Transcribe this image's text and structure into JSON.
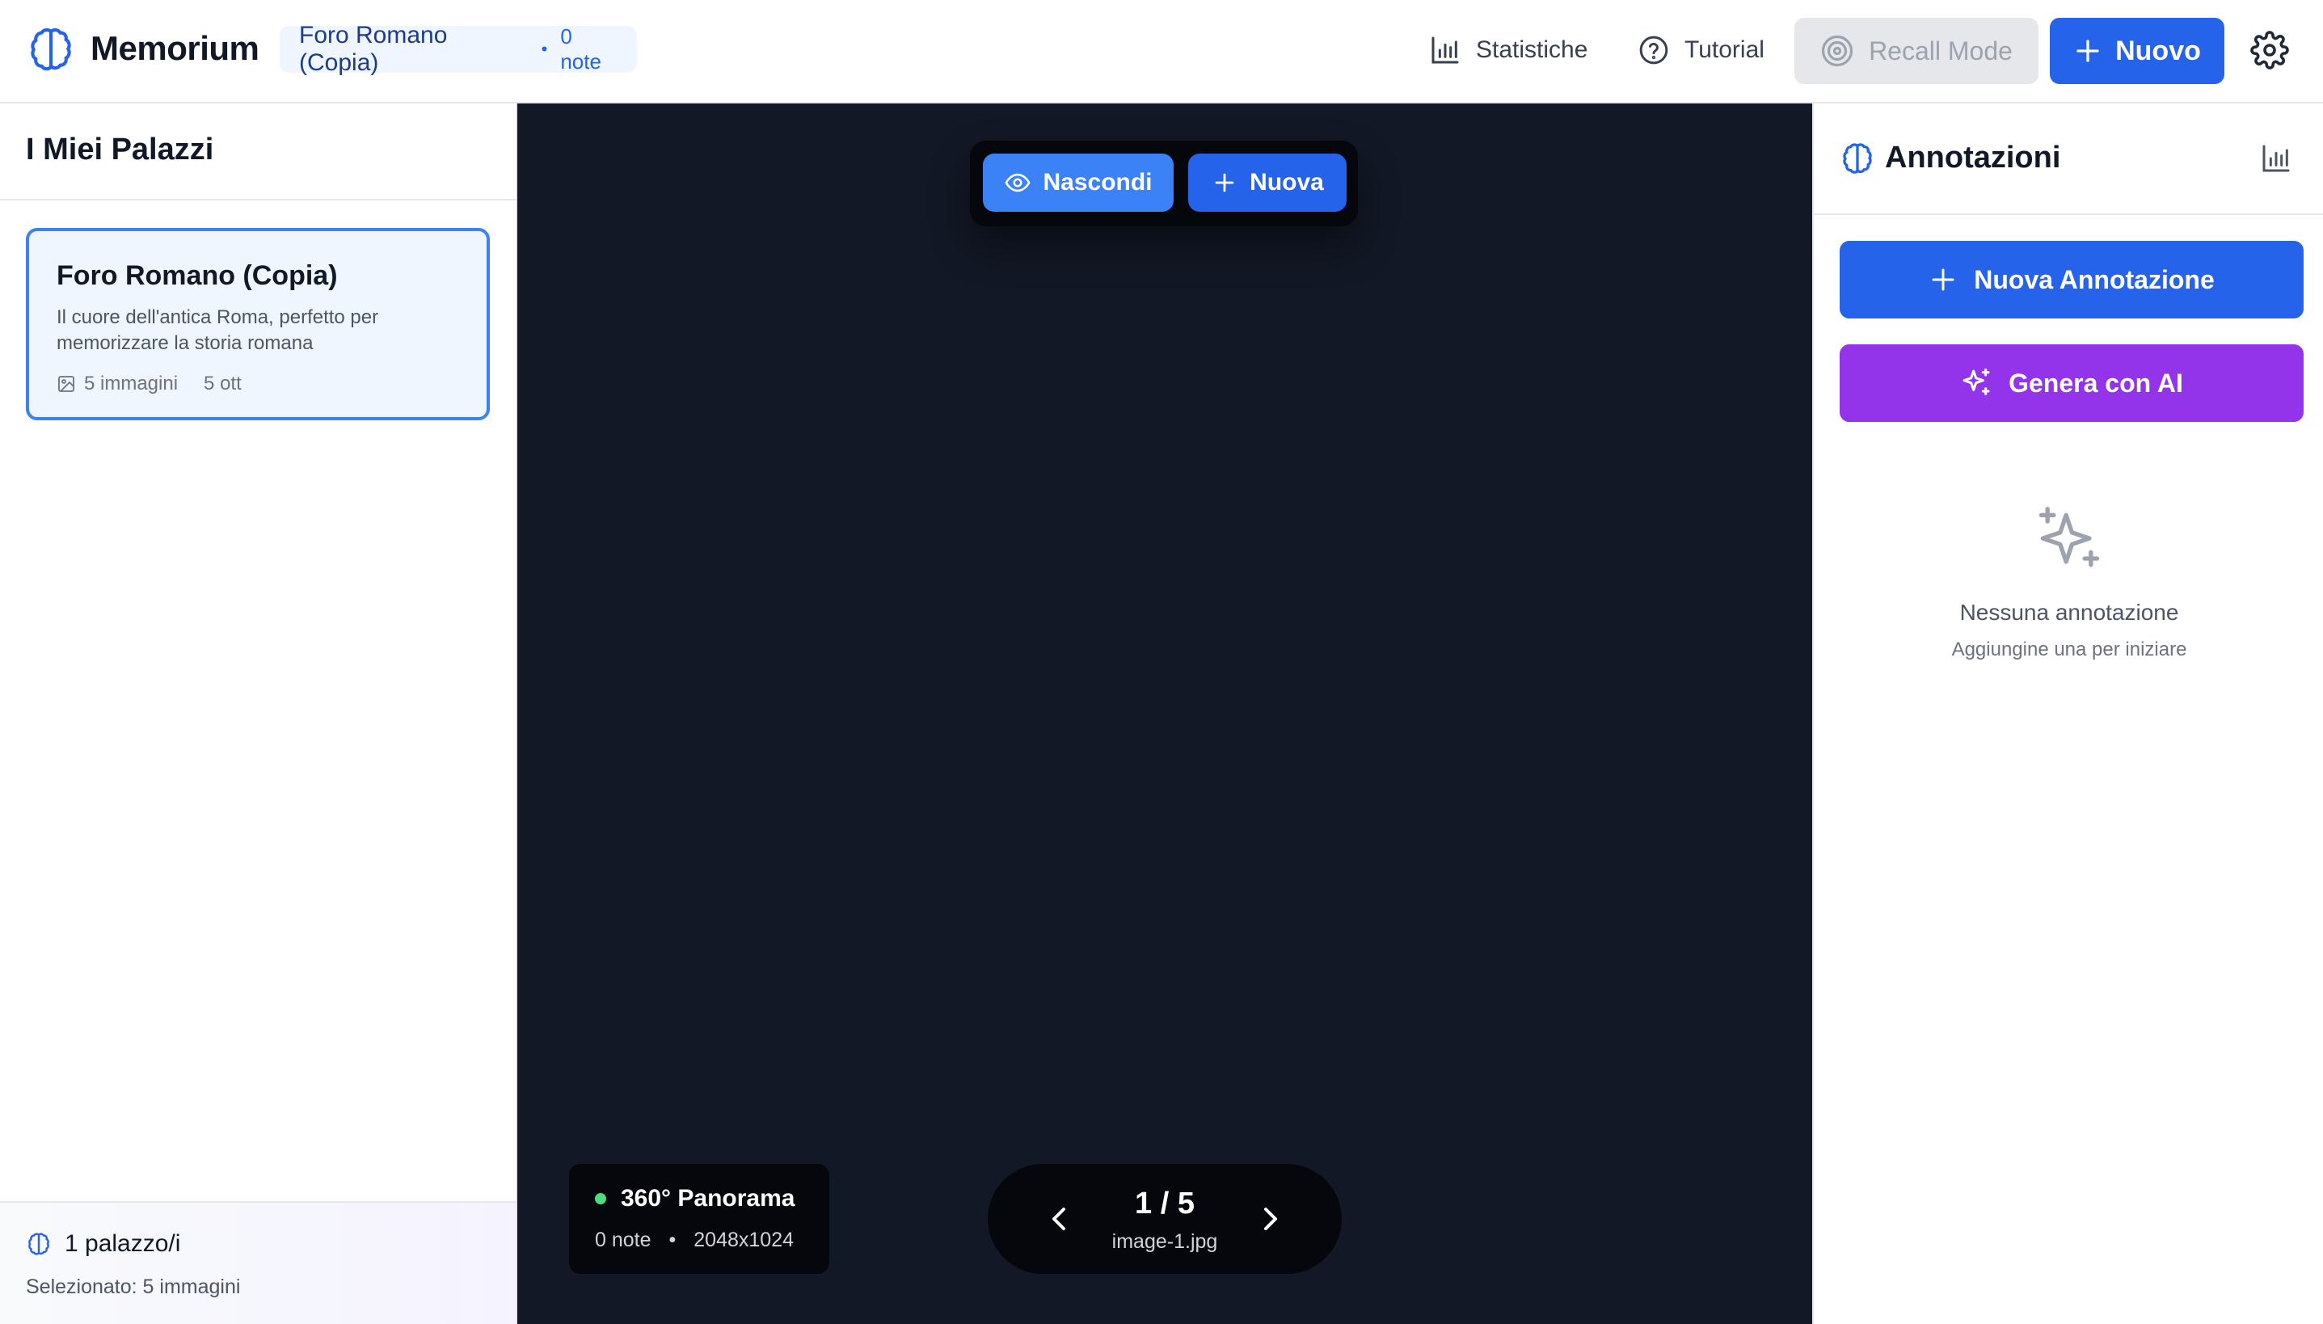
{
  "app": {
    "title": "Memorium",
    "current_palace": "Foro Romano (Copia)",
    "current_notes": "0 note"
  },
  "header": {
    "stats_label": "Statistiche",
    "tutorial_label": "Tutorial",
    "recall_label": "Recall Mode",
    "new_label": "Nuovo"
  },
  "sidebar": {
    "title": "I Miei Palazzi",
    "palaces": [
      {
        "name": "Foro Romano (Copia)",
        "description": "Il cuore dell'antica Roma, perfetto per memorizzare la storia romana",
        "images": "5 immagini",
        "date": "5 ott",
        "selected": true
      }
    ],
    "footer": {
      "count": "1 palazzo/i",
      "selected": "Selezionato: 5 immagini"
    }
  },
  "viewer": {
    "toolbar": {
      "hide_label": "Nascondi",
      "add_label": "Nuova"
    },
    "info": {
      "mode": "360° Panorama",
      "notes": "0 note",
      "separator": "•",
      "resolution": "2048x1024"
    },
    "nav": {
      "counter": "1 / 5",
      "filename": "image-1.jpg"
    }
  },
  "annotations": {
    "title": "Annotazioni",
    "new_button": "Nuova Annotazione",
    "ai_button": "Genera con AI",
    "empty_title": "Nessuna annotazione",
    "empty_subtitle": "Aggiungine una per iniziare"
  },
  "colors": {
    "primary": "#2563eb",
    "ai_purple": "#9333ea",
    "viewer_bg": "#131826",
    "selected_card_bg": "#eff6ff",
    "status_green": "#4ade80"
  },
  "icons": [
    "brain-icon",
    "bar-chart-icon",
    "help-circle-icon",
    "target-icon",
    "plus-icon",
    "gear-icon",
    "image-icon",
    "eye-icon",
    "chevron-left-icon",
    "chevron-right-icon",
    "sparkles-icon"
  ]
}
